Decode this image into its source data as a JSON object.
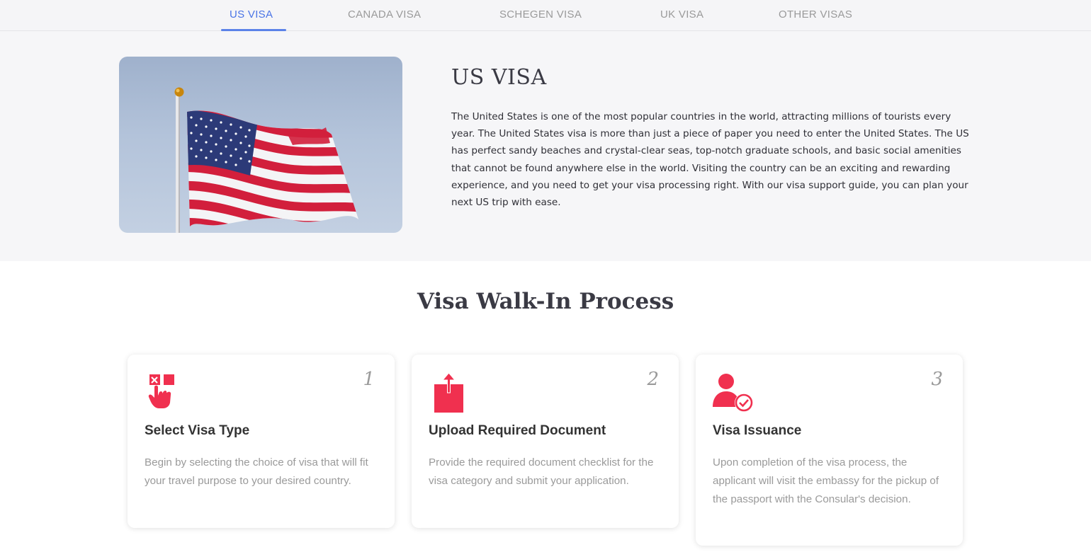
{
  "tabs": [
    {
      "label": "US VISA",
      "active": true
    },
    {
      "label": "CANADA VISA",
      "active": false
    },
    {
      "label": "SCHEGEN VISA",
      "active": false
    },
    {
      "label": "UK VISA",
      "active": false
    },
    {
      "label": "OTHER VISAS",
      "active": false
    }
  ],
  "hero": {
    "title": "US VISA",
    "description": "The United States is one of the most popular countries in the world, attracting millions of tourists every year. The United States visa is more than just a piece of paper you need to enter the United States. The US has perfect sandy beaches and crystal-clear seas, top-notch graduate schools, and basic social amenities that cannot be found anywhere else in the world. Visiting the country can be an exciting and rewarding experience, and you need to get your visa processing right. With our visa support guide, you can plan your next US trip with ease.",
    "image_icon": "us-flag"
  },
  "process": {
    "title": "Visa Walk-In Process",
    "steps": [
      {
        "number": "1",
        "icon": "select-touch-icon",
        "title": "Select Visa Type",
        "text": "Begin by selecting the choice of visa that will fit your travel purpose to your desired country."
      },
      {
        "number": "2",
        "icon": "upload-box-icon",
        "title": "Upload Required Document",
        "text": "Provide the required document checklist for the visa category and submit your application."
      },
      {
        "number": "3",
        "icon": "user-check-icon",
        "title": "Visa Issuance",
        "text": "Upon completion of the visa process, the applicant will visit the embassy for the pickup of the passport with the Consular's decision."
      }
    ]
  },
  "colors": {
    "accent": "#4a74e6",
    "icon_red": "#f0304f",
    "muted_text": "#9a9a9a"
  }
}
